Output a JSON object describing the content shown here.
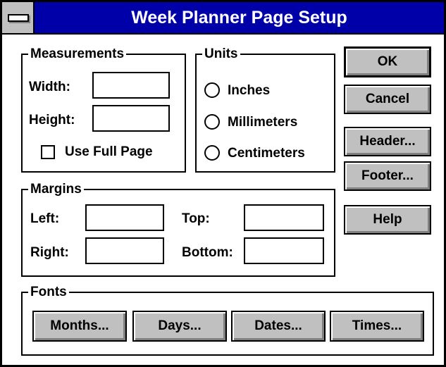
{
  "window": {
    "title": "Week Planner Page Setup"
  },
  "measurements": {
    "legend": "Measurements",
    "width_label": "Width:",
    "width_value": "",
    "height_label": "Height:",
    "height_value": "",
    "use_full_page_label": "Use Full Page",
    "use_full_page_checked": false
  },
  "units": {
    "legend": "Units",
    "options": [
      "Inches",
      "Millimeters",
      "Centimeters"
    ],
    "selected": null
  },
  "margins": {
    "legend": "Margins",
    "left_label": "Left:",
    "left_value": "",
    "top_label": "Top:",
    "top_value": "",
    "right_label": "Right:",
    "right_value": "",
    "bottom_label": "Bottom:",
    "bottom_value": ""
  },
  "fonts": {
    "legend": "Fonts",
    "buttons": [
      "Months...",
      "Days...",
      "Dates...",
      "Times..."
    ]
  },
  "buttons": {
    "ok": "OK",
    "cancel": "Cancel",
    "header": "Header...",
    "footer": "Footer...",
    "help": "Help"
  },
  "colors": {
    "titlebar": "#0000a8",
    "button_face": "#c0c0c0",
    "background": "#ffffff"
  }
}
